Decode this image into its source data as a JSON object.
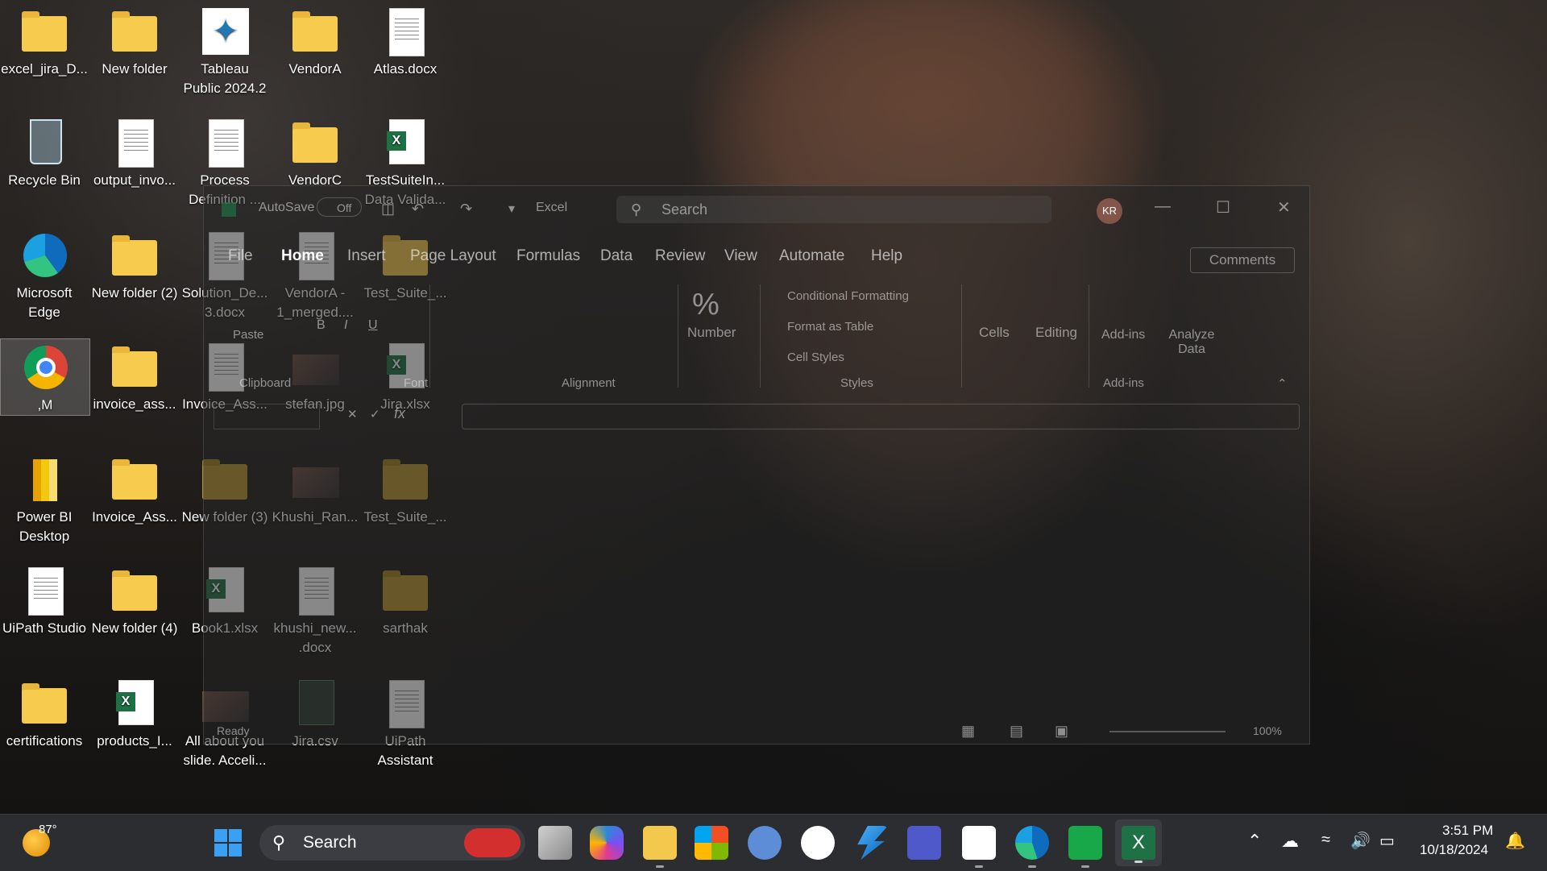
{
  "desktop": {
    "icons": [
      {
        "label": "excel_jira_D...",
        "type": "folder"
      },
      {
        "label": "New folder",
        "type": "folder"
      },
      {
        "label": "Tableau Public 2024.2",
        "type": "tableau"
      },
      {
        "label": "VendorA",
        "type": "folder"
      },
      {
        "label": "Atlas.docx",
        "type": "doc"
      },
      {
        "label": "Recycle Bin",
        "type": "recycle"
      },
      {
        "label": "output_invo...",
        "type": "doc"
      },
      {
        "label": "Process Definition ...",
        "type": "doc"
      },
      {
        "label": "VendorC",
        "type": "folder"
      },
      {
        "label": "TestSuiteIn... Data Valida...",
        "type": "excel"
      },
      {
        "label": "Microsoft Edge",
        "type": "edge"
      },
      {
        "label": "New folder (2)",
        "type": "folder"
      },
      {
        "label": "Solution_De... 3.docx",
        "type": "doc"
      },
      {
        "label": "VendorA - 1_merged....",
        "type": "doc"
      },
      {
        "label": "Test_Suite_...",
        "type": "folder"
      },
      {
        "label": ",M",
        "type": "chrome"
      },
      {
        "label": "invoice_ass...",
        "type": "folder"
      },
      {
        "label": "Invoice_Ass...",
        "type": "doc"
      },
      {
        "label": "stefan.jpg",
        "type": "photo"
      },
      {
        "label": "Jira.xlsx",
        "type": "excel"
      },
      {
        "label": "Power BI Desktop",
        "type": "powerbi"
      },
      {
        "label": "Invoice_Ass...",
        "type": "folder"
      },
      {
        "label": "New folder (3)",
        "type": "folder"
      },
      {
        "label": "Khushi_Ran...",
        "type": "photo"
      },
      {
        "label": "Test_Suite_...",
        "type": "folder"
      },
      {
        "label": "UiPath Studio",
        "type": "doc"
      },
      {
        "label": "New folder (4)",
        "type": "folder"
      },
      {
        "label": "Book1.xlsx",
        "type": "excel"
      },
      {
        "label": "khushi_new... .docx",
        "type": "doc"
      },
      {
        "label": "sarthak",
        "type": "folder"
      },
      {
        "label": "certifications",
        "type": "folder"
      },
      {
        "label": "products_I...",
        "type": "excel"
      },
      {
        "label": "All about you slide. Acceli...",
        "type": "photo"
      },
      {
        "label": "Jira.csv",
        "type": "csv"
      },
      {
        "label": "UiPath Assistant",
        "type": "doc"
      }
    ]
  },
  "excel": {
    "autosave_label": "AutoSave",
    "autosave_state": "Off",
    "app_name": "Excel",
    "search_placeholder": "Search",
    "avatar_initials": "KR",
    "comments_label": "Comments",
    "tabs": [
      "File",
      "Home",
      "Insert",
      "Page Layout",
      "Formulas",
      "Data",
      "Review",
      "View",
      "Automate",
      "Help"
    ],
    "ribbon": {
      "paste": "Paste",
      "clipboard": "Clipboard",
      "font": "Font",
      "alignment": "Alignment",
      "number": "Number",
      "conditional_formatting": "Conditional Formatting",
      "format_as_table": "Format as Table",
      "cell_styles": "Cell Styles",
      "styles": "Styles",
      "cells": "Cells",
      "editing": "Editing",
      "addins_btn": "Add-ins",
      "analyze_data": "Analyze Data",
      "addins_group": "Add-ins"
    },
    "status_ready": "Ready",
    "zoom": "100%"
  },
  "taskbar": {
    "weather_temp": "87°",
    "search_label": "Search",
    "time": "3:51 PM",
    "date": "10/18/2024"
  }
}
